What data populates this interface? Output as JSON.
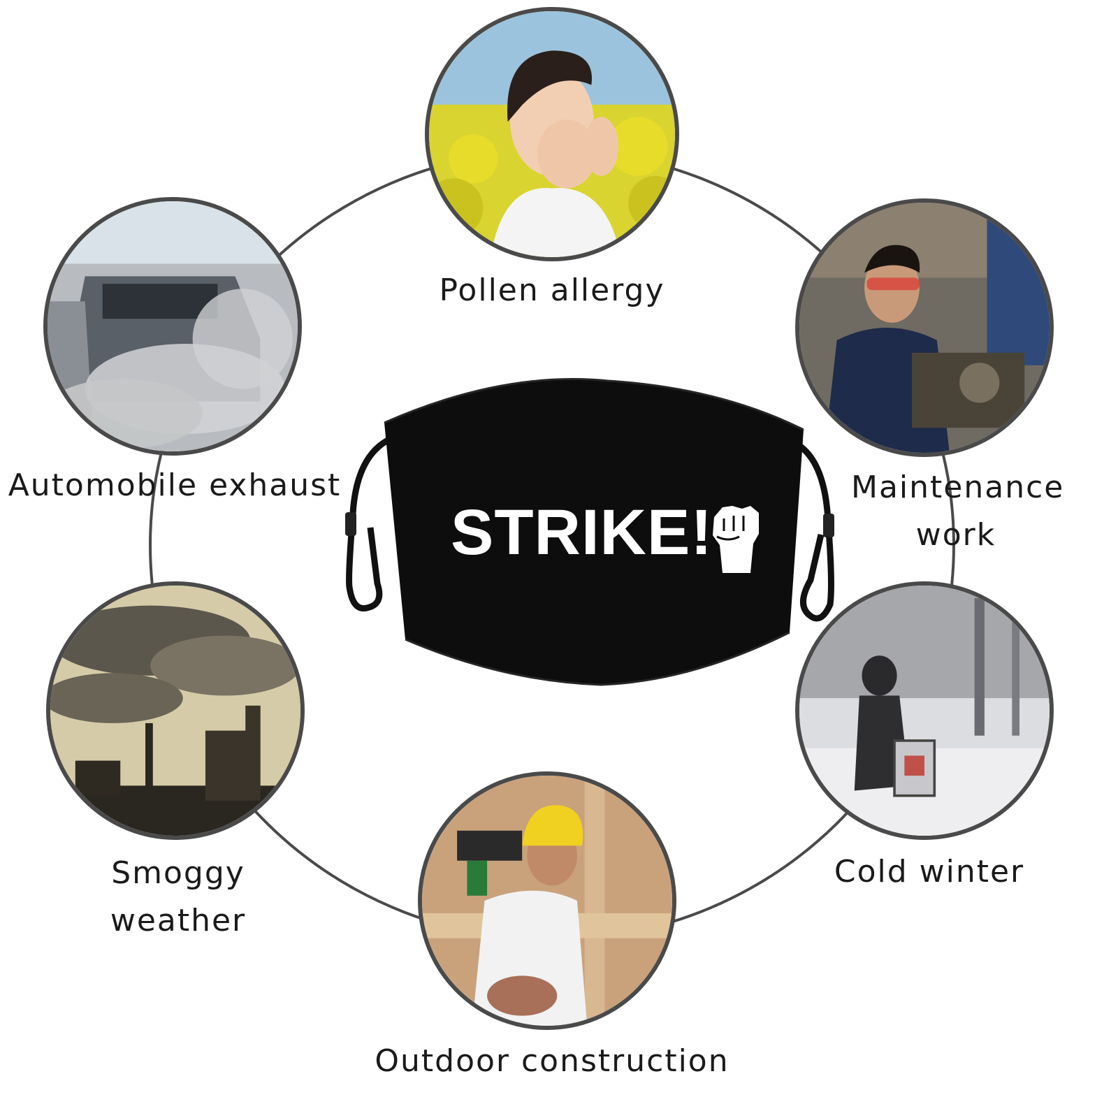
{
  "center_product": {
    "print_text": "STRIKE!",
    "icon": "raised-fist-icon",
    "colors": {
      "mask": "#0d0d0d",
      "print": "#ffffff"
    }
  },
  "scenarios": [
    {
      "id": "pollen",
      "label": "Pollen allergy"
    },
    {
      "id": "auto",
      "label": "Automobile exhaust"
    },
    {
      "id": "maint",
      "label": "Maintenance work"
    },
    {
      "id": "smog",
      "label": "Smoggy weather"
    },
    {
      "id": "winter",
      "label": "Cold winter"
    },
    {
      "id": "construct",
      "label": "Outdoor construction"
    }
  ],
  "colors": {
    "ring": "#4a4a4a",
    "text": "#1a1a1a",
    "background": "#ffffff"
  }
}
